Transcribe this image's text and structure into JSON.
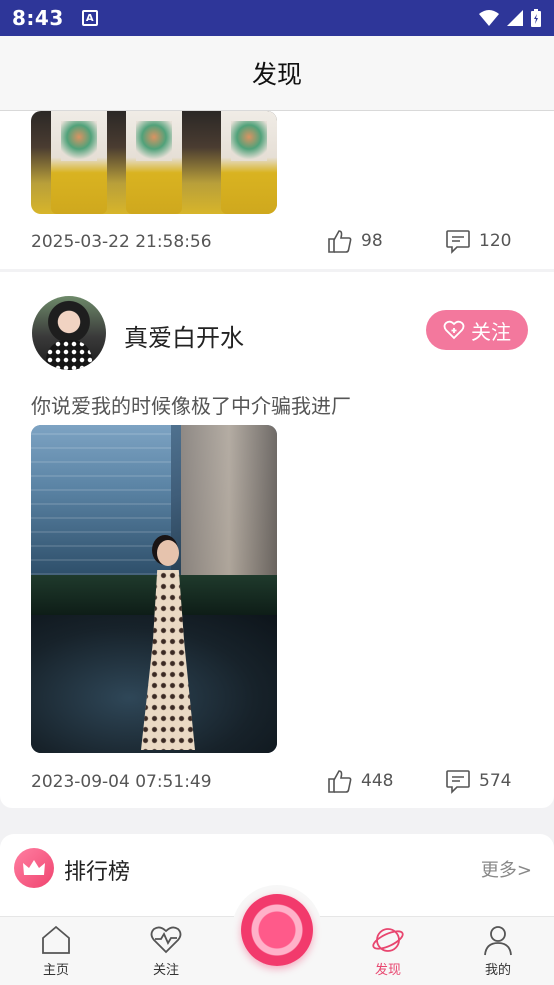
{
  "status_bar": {
    "time": "8:43",
    "notification_icon": "A"
  },
  "header": {
    "title": "发现"
  },
  "posts": [
    {
      "timestamp": "2025-03-22 21:58:56",
      "likes": "98",
      "comments": "120"
    },
    {
      "username": "真爱白开水",
      "follow_label": "关注",
      "text": "你说爱我的时候像极了中介骗我进厂",
      "timestamp": "2023-09-04 07:51:49",
      "likes": "448",
      "comments": "574"
    }
  ],
  "ranking": {
    "title": "排行榜",
    "more_label": "更多>"
  },
  "tabbar": {
    "items": [
      {
        "label": "主页"
      },
      {
        "label": "关注"
      },
      {
        "label": "发现"
      },
      {
        "label": "我的"
      }
    ]
  },
  "colors": {
    "accent": "#e8466f",
    "status_bar": "#2e3699",
    "follow_bg": "#f3789d"
  }
}
